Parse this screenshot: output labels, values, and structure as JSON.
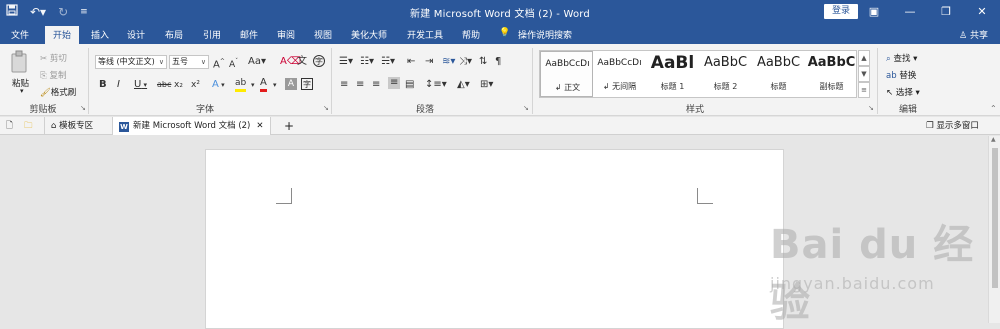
{
  "window": {
    "title": "新建 Microsoft Word 文档 (2)  -  Word",
    "login_label": "登录",
    "share_label": "共享"
  },
  "tabs": [
    {
      "label": "文件",
      "active": false
    },
    {
      "label": "开始",
      "active": true
    },
    {
      "label": "插入",
      "active": false
    },
    {
      "label": "设计",
      "active": false
    },
    {
      "label": "布局",
      "active": false
    },
    {
      "label": "引用",
      "active": false
    },
    {
      "label": "邮件",
      "active": false
    },
    {
      "label": "审阅",
      "active": false
    },
    {
      "label": "视图",
      "active": false
    },
    {
      "label": "美化大师",
      "active": false
    },
    {
      "label": "开发工具",
      "active": false
    },
    {
      "label": "帮助",
      "active": false
    }
  ],
  "tell_me": "操作说明搜索",
  "clipboard": {
    "group_label": "剪贴板",
    "paste": "粘贴",
    "cut": "剪切",
    "copy": "复制",
    "format_painter": "格式刷"
  },
  "font": {
    "group_label": "字体",
    "font_name": "等线 (中文正文)",
    "font_size": "五号",
    "grow": "A",
    "shrink": "A",
    "case": "Aa",
    "clear": "A",
    "phonetic": "文",
    "enclose": "字",
    "bold": "B",
    "italic": "I",
    "underline": "U",
    "strike": "abc",
    "subscript": "x₂",
    "superscript": "x²",
    "text_effect": "A",
    "highlight": "ab",
    "font_color": "A",
    "char_shading": "A",
    "char_border": "字"
  },
  "paragraph": {
    "group_label": "段落"
  },
  "styles": {
    "group_label": "样式",
    "items": [
      {
        "preview": "AaBbCcDı",
        "name": "↲ 正文"
      },
      {
        "preview": "AaBbCcDı",
        "name": "↲ 无间隔"
      },
      {
        "preview": "AaBl",
        "name": "标题 1"
      },
      {
        "preview": "AaBbC",
        "name": "标题 2"
      },
      {
        "preview": "AaBbC",
        "name": "标题"
      },
      {
        "preview": "AaBbC",
        "name": "副标题"
      }
    ]
  },
  "editing": {
    "group_label": "编辑",
    "find": "查找",
    "replace": "替换",
    "select": "选择"
  },
  "doc_tabs": {
    "templates": "模板专区",
    "document": "新建 Microsoft Word 文档 (2)",
    "show_multi": "显示多窗口"
  },
  "watermark": {
    "main": "Bai du 经验",
    "sub": "jingyan.baidu.com"
  },
  "colors": {
    "brand": "#2b579a",
    "ribbon": "#f3f3f3",
    "workspace": "#e6e6e6",
    "highlight_yellow": "#ffeb00",
    "font_red": "#e31c1c"
  }
}
